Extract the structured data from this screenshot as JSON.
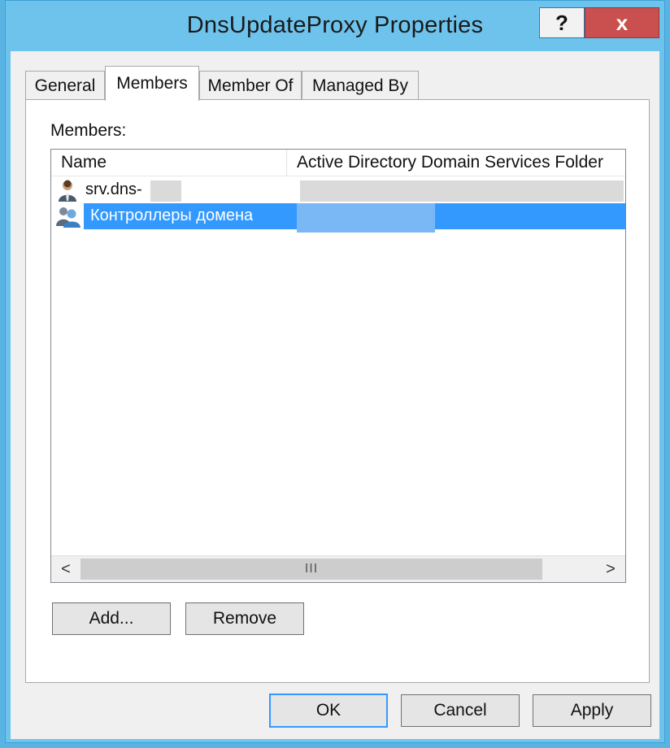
{
  "window": {
    "title": "DnsUpdateProxy Properties",
    "help_label": "?",
    "close_label": "x"
  },
  "tabs": [
    {
      "label": "General"
    },
    {
      "label": "Members"
    },
    {
      "label": "Member Of"
    },
    {
      "label": "Managed By"
    }
  ],
  "active_tab": "Members",
  "members_panel": {
    "label": "Members:",
    "columns": [
      "Name",
      "Active Directory Domain Services Folder"
    ],
    "rows": [
      {
        "name": "srv.dns-",
        "folder": "",
        "icon": "user-icon",
        "selected": false
      },
      {
        "name": "Контроллеры домена",
        "folder": "",
        "icon": "group-icon",
        "selected": true
      }
    ],
    "scroll_thumb_label": "III",
    "scroll_left": "<",
    "scroll_right": ">"
  },
  "buttons": {
    "add": "Add...",
    "remove": "Remove",
    "ok": "OK",
    "cancel": "Cancel",
    "apply": "Apply"
  },
  "colors": {
    "window_frame": "#6ec3ec",
    "close_button": "#c9504e",
    "selection": "#3399ff",
    "dialog_bg": "#f0f0f0"
  }
}
